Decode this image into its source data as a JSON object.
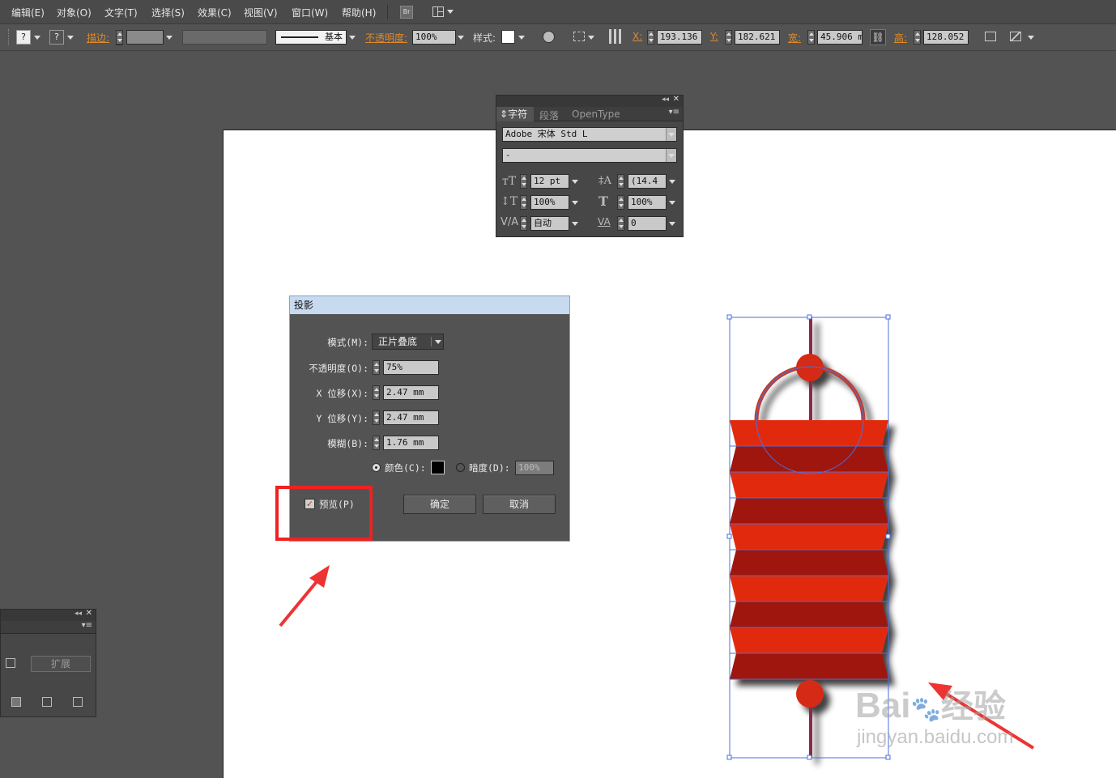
{
  "menu": [
    "编辑(E)",
    "对象(O)",
    "文字(T)",
    "选择(S)",
    "效果(C)",
    "视图(V)",
    "窗口(W)",
    "帮助(H)"
  ],
  "menu_icon_br": "Br",
  "control": {
    "stroke_label": "描边:",
    "stroke_profile": "基本",
    "opacity_label": "不透明度:",
    "opacity_value": "100%",
    "style_label": "样式:",
    "x_label": "X:",
    "x_value": "193.136",
    "y_label": "Y:",
    "y_value": "182.621",
    "w_label": "宽:",
    "w_value": "45.906 m",
    "h_label": "高:",
    "h_value": "128.052",
    "unknown_mark": "?"
  },
  "char_panel": {
    "tabs": [
      "字符",
      "段落",
      "OpenType"
    ],
    "font_family": "Adobe 宋体 Std L",
    "font_style": "-",
    "font_size": "12 pt",
    "leading": "(14.4",
    "vscale": "100%",
    "hscale": "100%",
    "kerning": "自动",
    "tracking": "0"
  },
  "dialog": {
    "title": "投影",
    "mode_label": "模式(M):",
    "mode_value": "正片叠底",
    "opacity_label": "不透明度(O):",
    "opacity_value": "75%",
    "xoffset_label": "X 位移(X):",
    "xoffset_value": "2.47 mm",
    "yoffset_label": "Y 位移(Y):",
    "yoffset_value": "2.47 mm",
    "blur_label": "模糊(B):",
    "blur_value": "1.76 mm",
    "color_label": "颜色(C):",
    "darkness_label": "暗度(D):",
    "darkness_value": "100%",
    "preview_label": "预览(P)",
    "preview_checked": true,
    "ok_label": "确定",
    "cancel_label": "取消",
    "color_swatch": "#000000"
  },
  "small_panel": {
    "expand_label": "扩展"
  },
  "watermark": {
    "brand": "Bai",
    "brand2": "经验",
    "url": "jingyan.baidu.com"
  },
  "colors": {
    "lantern_light": "#e12b0e",
    "lantern_dark": "#9e160b",
    "selection": "#4a6fe0",
    "annotation": "#ee3333"
  }
}
